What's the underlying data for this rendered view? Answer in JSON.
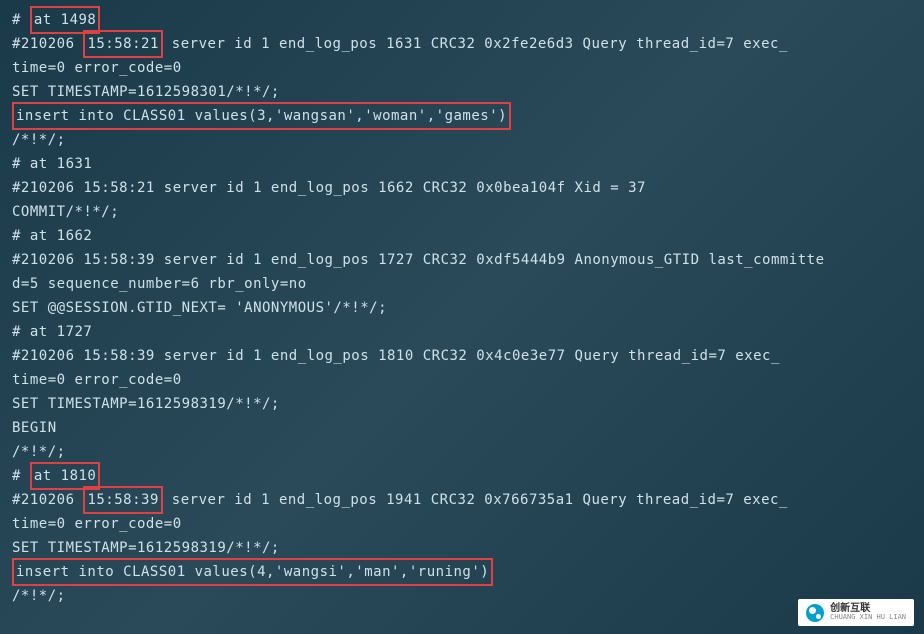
{
  "lines": {
    "l1_prefix": "# ",
    "l1_hl": "at 1498",
    "l2_prefix": "#210206 ",
    "l2_hl": "15:58:21",
    "l2_suffix": " server id 1  end_log_pos 1631 CRC32 0x2fe2e6d3        Query   thread_id=7     exec_",
    "l3": "time=0  error_code=0",
    "l4": "SET TIMESTAMP=1612598301/*!*/;",
    "l5_hl": "insert into CLASS01 values(3,'wangsan','woman','games')",
    "l6": "/*!*/;",
    "l7": "# at 1631",
    "l8": "#210206 15:58:21 server id 1  end_log_pos 1662 CRC32 0x0bea104f        Xid = 37",
    "l9": "COMMIT/*!*/;",
    "l10": "# at 1662",
    "l11": "#210206 15:58:39 server id 1  end_log_pos 1727 CRC32 0xdf5444b9        Anonymous_GTID  last_committe",
    "l12": "d=5     sequence_number=6       rbr_only=no",
    "l13": "SET @@SESSION.GTID_NEXT= 'ANONYMOUS'/*!*/;",
    "l14": "# at 1727",
    "l15": "#210206 15:58:39 server id 1  end_log_pos 1810 CRC32 0x4c0e3e77        Query   thread_id=7     exec_",
    "l16": "time=0  error_code=0",
    "l17": "SET TIMESTAMP=1612598319/*!*/;",
    "l18": "BEGIN",
    "l19": "/*!*/;",
    "l20_prefix": "# ",
    "l20_hl": "at 1810",
    "l21_prefix": "#210206 ",
    "l21_hl": "15:58:39",
    "l21_suffix": " server id 1  end_log_pos 1941 CRC32 0x766735a1        Query   thread_id=7     exec_",
    "l22": "time=0  error_code=0",
    "l23": "SET TIMESTAMP=1612598319/*!*/;",
    "l24_hl": "insert into CLASS01 values(4,'wangsi','man','runing')",
    "l25": "/*!*/;"
  },
  "watermark": {
    "cn": "创新互联",
    "en": "CHUANG XIN HU LIAN"
  }
}
